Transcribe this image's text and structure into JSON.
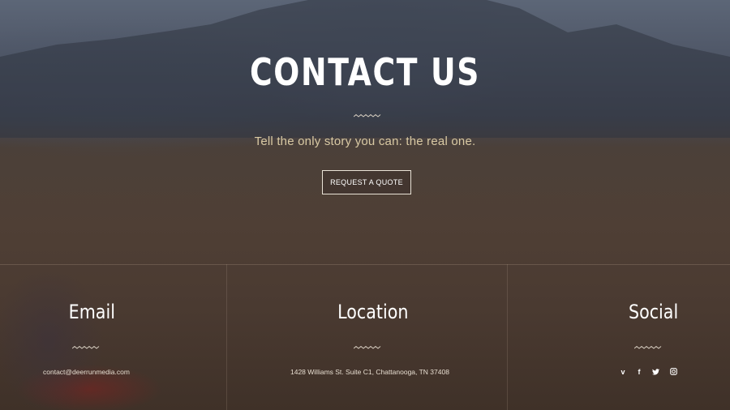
{
  "hero": {
    "title": "CONTACT US",
    "tagline": "Tell the only story you can: the real one.",
    "quote_button_label": "REQUEST A QUOTE"
  },
  "footer": {
    "email": {
      "heading": "Email",
      "value": "contact@deerrunmedia.com"
    },
    "location": {
      "heading": "Location",
      "value": "1428 Williams St. Suite C1, Chattanooga, TN 37408"
    },
    "social": {
      "heading": "Social",
      "icons": [
        "vimeo-icon",
        "facebook-icon",
        "twitter-icon",
        "instagram-icon"
      ],
      "glyphs": {
        "vimeo": "v",
        "facebook": "f"
      }
    }
  },
  "colors": {
    "accent_text": "#d9c9a3",
    "button_border": "#e9e2d6"
  }
}
